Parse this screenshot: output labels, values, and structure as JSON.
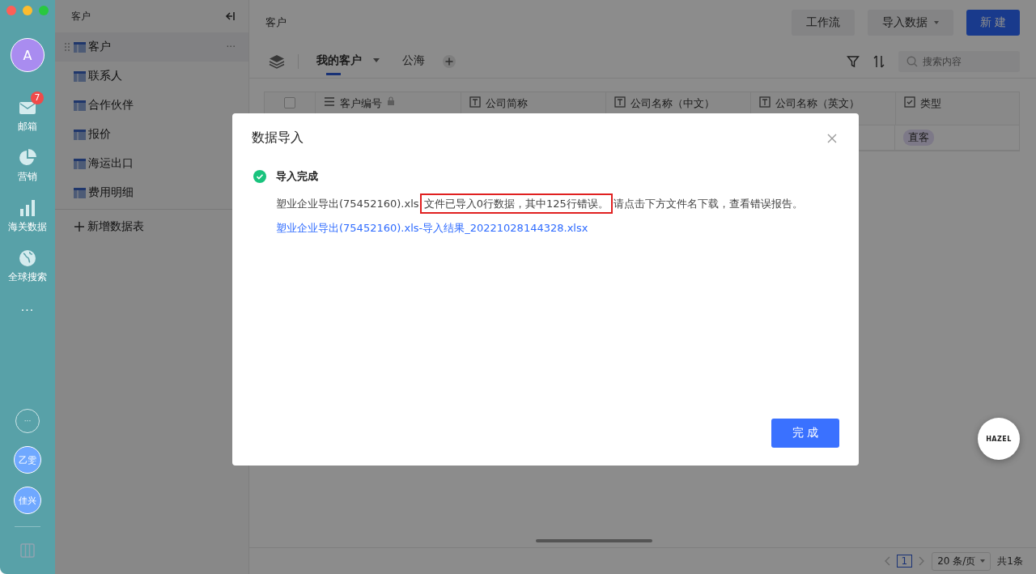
{
  "rail": {
    "avatar": "A",
    "items": [
      {
        "kind": "mail",
        "label": "邮箱",
        "badge": "7"
      },
      {
        "kind": "pie",
        "label": "营销"
      },
      {
        "kind": "bars",
        "label": "海关数据"
      },
      {
        "kind": "globe",
        "label": "全球搜索"
      }
    ],
    "more": "···",
    "bottom_more": "···",
    "users": [
      "乙雯",
      "佳兴"
    ]
  },
  "sidebar": {
    "title": "客户",
    "items": [
      {
        "label": "客户",
        "selected": true,
        "more": "···"
      },
      {
        "label": "联系人",
        "selected": false
      },
      {
        "label": "合作伙伴",
        "selected": false
      },
      {
        "label": "报价",
        "selected": false
      },
      {
        "label": "海运出口",
        "selected": false
      },
      {
        "label": "费用明细",
        "selected": false
      }
    ],
    "add": "新增数据表"
  },
  "header": {
    "title": "客户",
    "buttons": [
      {
        "label": "工作流",
        "kind": "plain"
      },
      {
        "label": "导入数据",
        "kind": "dropdown"
      },
      {
        "label": "新 建",
        "kind": "primary"
      }
    ]
  },
  "tabs": [
    {
      "label": "我的客户",
      "selected": true,
      "dropdown": true
    },
    {
      "label": "公海",
      "selected": false,
      "dropdown": false
    }
  ],
  "search": {
    "placeholder": "搜索内容"
  },
  "table": {
    "columns": [
      {
        "label": "客户编号",
        "kind": "list",
        "locked": true
      },
      {
        "label": "公司简称",
        "kind": "text",
        "locked": false
      },
      {
        "label": "公司名称（中文）",
        "kind": "text",
        "locked": false
      },
      {
        "label": "公司名称（英文）",
        "kind": "text",
        "locked": false
      },
      {
        "label": "类型",
        "kind": "check",
        "locked": false
      }
    ],
    "select_all": {
      "checked": false
    },
    "rows": [
      {
        "tag": "直客"
      }
    ]
  },
  "pagination": {
    "page": "1",
    "page_size": "20 条/页",
    "total": "共1条"
  },
  "dialog": {
    "title": "数据导入",
    "status": "导入完成",
    "message_before": "塑业企业导出(75452160).xls ",
    "message_highlight": "文件已导入0行数据，其中125行错误。",
    "message_after": "请点击下方文件名下载，查看错误报告。",
    "link": "塑业企业导出(75452160).xls-导入结果_20221028144328.xlsx",
    "button": "完 成"
  },
  "floating": {
    "label": "HAZEL"
  }
}
